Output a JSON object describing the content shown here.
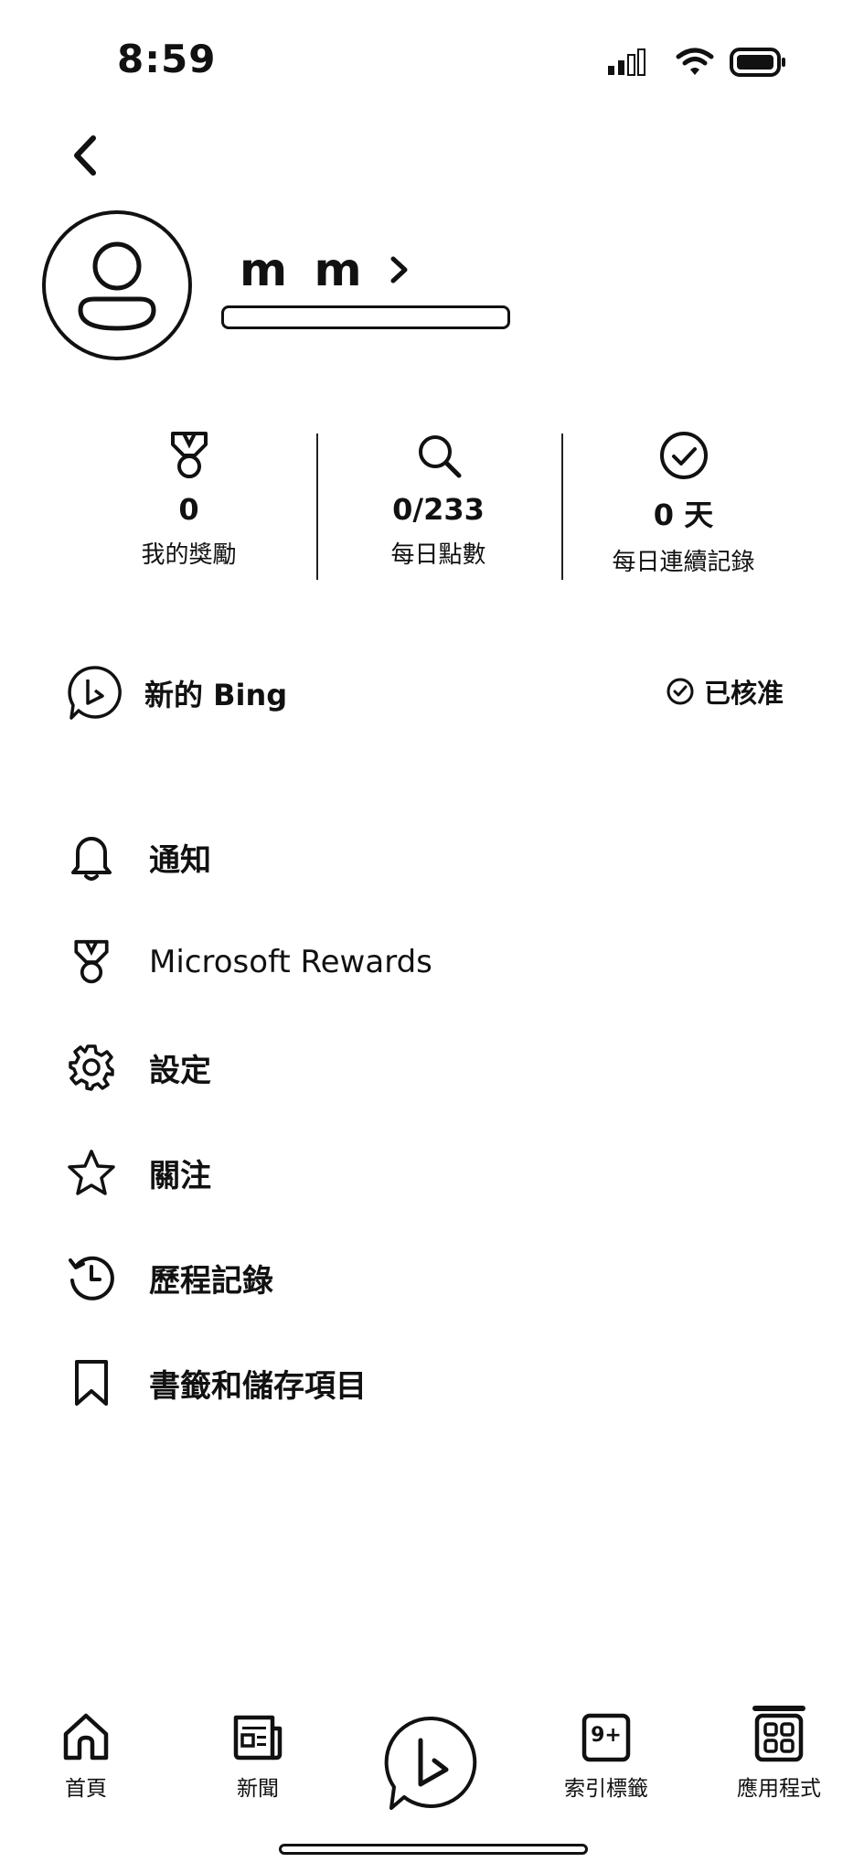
{
  "status_bar": {
    "time": "8:59",
    "icons": [
      "signal-icon",
      "wifi-icon",
      "battery-icon"
    ]
  },
  "profile": {
    "name": "m m",
    "avatar_icon": "person-icon"
  },
  "stats": [
    {
      "icon": "medal-icon",
      "value": "0",
      "label": "我的獎勵"
    },
    {
      "icon": "search-icon",
      "value": "0/233",
      "label": "每日點數"
    },
    {
      "icon": "check-circle-icon",
      "value": "0 天",
      "label": "每日連續記錄"
    }
  ],
  "bing": {
    "label": "新的 Bing",
    "status": "已核准"
  },
  "menu": [
    {
      "icon": "bell-icon",
      "label": "通知"
    },
    {
      "icon": "medal-icon",
      "label": "Microsoft Rewards"
    },
    {
      "icon": "gear-icon",
      "label": "設定"
    },
    {
      "icon": "star-icon",
      "label": "關注"
    },
    {
      "icon": "history-icon",
      "label": "歷程記錄"
    },
    {
      "icon": "bookmark-icon",
      "label": "書籤和儲存項目"
    }
  ],
  "bottom_nav": {
    "home": "首頁",
    "news": "新聞",
    "tabs": "索引標籤",
    "tabs_badge": "9+",
    "apps": "應用程式"
  },
  "colors": {
    "foreground": "#111111",
    "background": "#ffffff"
  }
}
